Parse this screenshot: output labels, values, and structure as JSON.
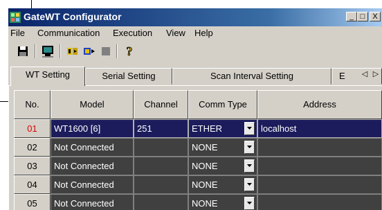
{
  "window": {
    "title": "GateWT Configurator",
    "minimize_label": "_",
    "maximize_label": "□",
    "close_label": "X"
  },
  "menu": {
    "items": [
      {
        "label": "File"
      },
      {
        "label": "Communication"
      },
      {
        "label": "Execution"
      },
      {
        "label": "View"
      },
      {
        "label": "Help"
      }
    ]
  },
  "toolbar": {
    "buttons": [
      {
        "icon": "save-icon"
      },
      {
        "icon": "connect-icon"
      },
      {
        "icon": "start-icon"
      },
      {
        "icon": "transfer-icon"
      },
      {
        "icon": "stop-icon"
      },
      {
        "icon": "help-icon"
      }
    ]
  },
  "tabs": [
    {
      "label": "WT Setting",
      "active": true
    },
    {
      "label": "Serial Setting"
    },
    {
      "label": "Scan Interval Setting"
    },
    {
      "label": "E"
    }
  ],
  "tab_scroll": {
    "left": "◁",
    "right": "▷"
  },
  "grid": {
    "columns": [
      {
        "label": "No."
      },
      {
        "label": "Model"
      },
      {
        "label": "Channel"
      },
      {
        "label": "Comm Type"
      },
      {
        "label": "Address"
      }
    ],
    "rows": [
      {
        "no": "01",
        "model": "WT1600  [6]",
        "channel": "251",
        "comm": "ETHER",
        "address": "localhost",
        "selected": true
      },
      {
        "no": "02",
        "model": "Not Connected",
        "channel": "",
        "comm": "NONE",
        "address": ""
      },
      {
        "no": "03",
        "model": "Not Connected",
        "channel": "",
        "comm": "NONE",
        "address": ""
      },
      {
        "no": "04",
        "model": "Not Connected",
        "channel": "",
        "comm": "NONE",
        "address": ""
      },
      {
        "no": "05",
        "model": "Not Connected",
        "channel": "",
        "comm": "NONE",
        "address": ""
      }
    ]
  },
  "colors": {
    "selected_row_number": "#e00000",
    "title_bar": "#0a246a"
  }
}
